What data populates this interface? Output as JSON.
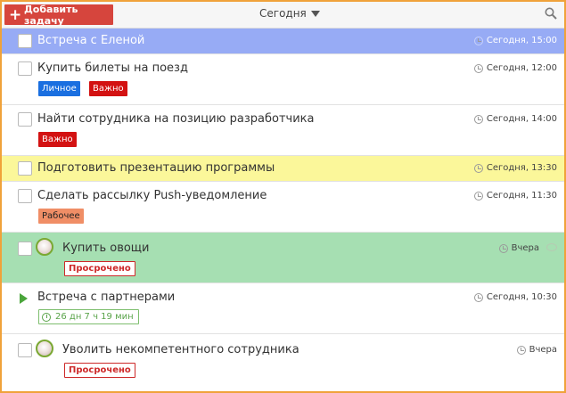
{
  "toolbar": {
    "add_label": "Добавить задачу",
    "filter_label": "Сегодня"
  },
  "tasks": [
    {
      "title": "Встреча с Еленой",
      "time": "Сегодня, 15:00",
      "bg": "#97abf5"
    },
    {
      "title": "Купить билеты на поезд",
      "time": "Сегодня, 12:00",
      "tags": [
        "Личное",
        "Важно"
      ]
    },
    {
      "title": "Найти сотрудника на позицию разработчика",
      "time": "Сегодня, 14:00",
      "tags": [
        "Важно"
      ]
    },
    {
      "title": "Подготовить презентацию программы",
      "time": "Сегодня, 13:30",
      "bg": "#fbf79a"
    },
    {
      "title": "Сделать рассылку Push-уведомление",
      "time": "Сегодня, 11:30",
      "tags": [
        "Рабочее"
      ]
    },
    {
      "title": "Купить овощи",
      "time": "Вчера",
      "status": "Просрочено",
      "bg": "#a6dfb2"
    },
    {
      "title": "Встреча с партнерами",
      "time": "Сегодня, 10:30",
      "timer": "26 дн 7 ч 19 мин"
    },
    {
      "title": "Уволить некомпетентного сотрудника",
      "time": "Вчера",
      "status": "Просрочено"
    }
  ],
  "colors": {
    "accent_add": "#d6453d",
    "frame_border": "#f0a23a",
    "tag_personal": "#1a6fe0",
    "tag_important": "#d31212",
    "tag_work": "#f08e66",
    "overdue": "#cd2929"
  },
  "icons": {
    "search": "search-icon",
    "clock": "clock-icon",
    "play": "play-icon",
    "timer": "timer-icon",
    "comment": "comment-icon",
    "avatar": "avatar"
  }
}
